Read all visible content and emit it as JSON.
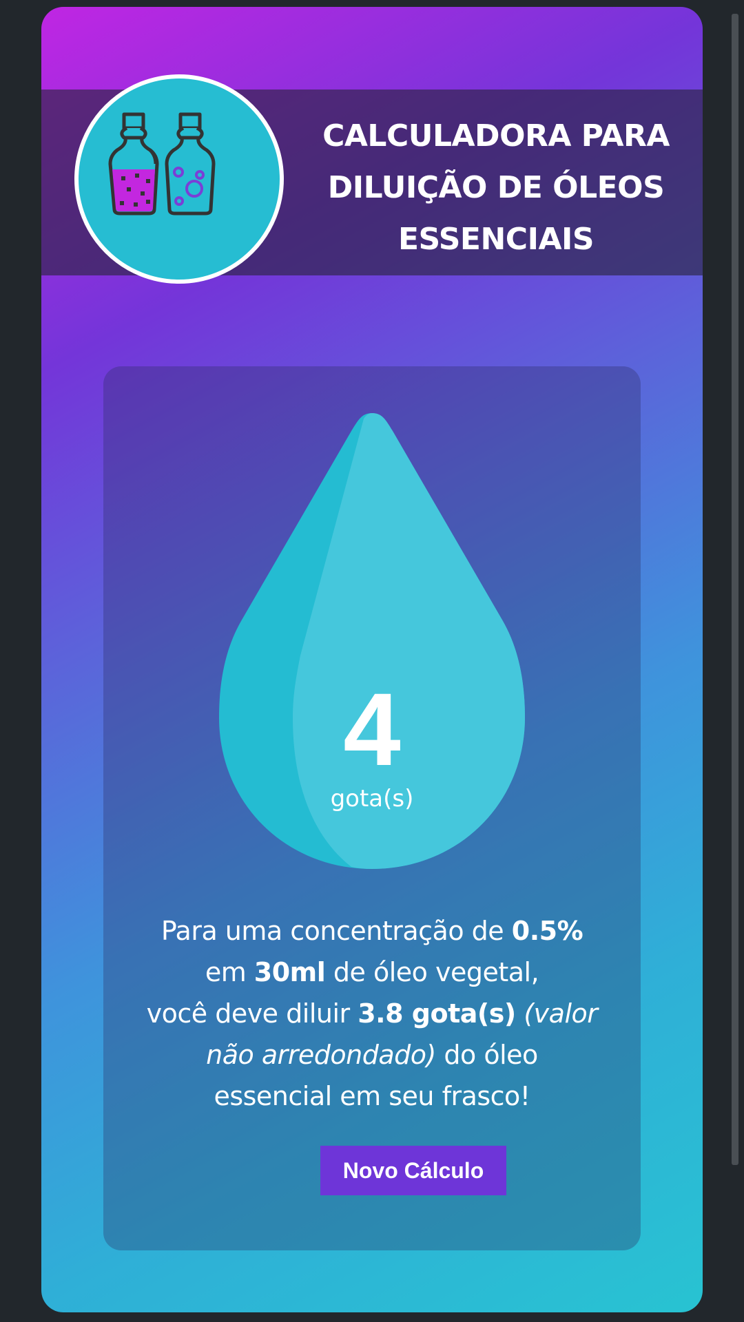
{
  "header": {
    "title": "CALCULADORA PARA DILUIÇÃO DE ÓLEOS ESSENCIAIS",
    "logo_icon": "essential-oil-bottles-icon"
  },
  "result": {
    "drops_rounded": "4",
    "drops_unit": "gota(s)",
    "text": {
      "p1": "Para uma concentração de ",
      "concentration": "0.5%",
      "p2": "em ",
      "volume": "30ml",
      "p3": " de óleo vegetal,",
      "p4": "você deve diluir ",
      "drops_exact": "3.8 gota(s)",
      "note": "(valor não arredondado)",
      "p5": " do óleo essencial em seu frasco!"
    }
  },
  "actions": {
    "new_calc_label": "Novo Cálculo"
  },
  "colors": {
    "gradient_start": "#c026e3",
    "gradient_mid": "#5c63da",
    "gradient_end": "#28c3d2",
    "drop_dark": "#24bcd2",
    "drop_light": "#48c7dc",
    "button": "#6e35d8",
    "bottle_left_fill": "#c327df",
    "bottle_right_fill": "#26bdd2"
  }
}
